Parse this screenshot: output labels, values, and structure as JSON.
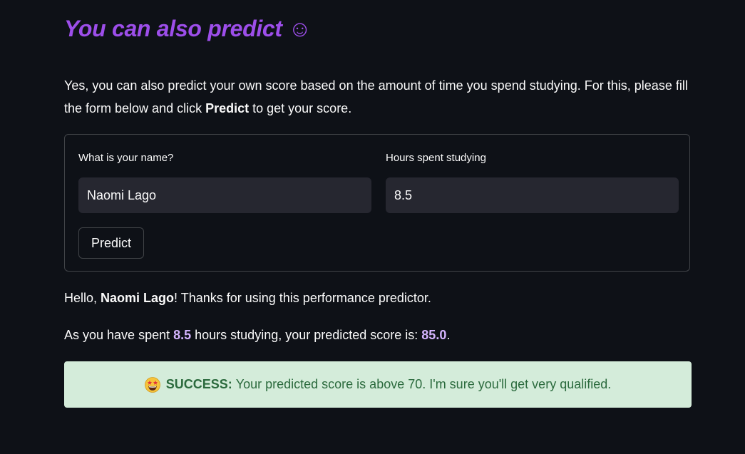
{
  "header": {
    "title": "You can also predict",
    "title_emoji": "☺"
  },
  "intro": {
    "text_before": "Yes, you can also predict your own score based on the amount of time you spend studying. For this, please fill the form below and click ",
    "bold": "Predict",
    "text_after": " to get your score."
  },
  "form": {
    "name_label": "What is your name?",
    "name_value": "Naomi Lago",
    "hours_label": "Hours spent studying",
    "hours_value": "8.5",
    "predict_label": "Predict"
  },
  "result": {
    "greeting_prefix": "Hello, ",
    "greeting_name": "Naomi Lago",
    "greeting_suffix": "! Thanks for using this performance predictor.",
    "score_prefix": "As you have spent ",
    "score_hours": "8.5",
    "score_mid": " hours studying, your predicted score is: ",
    "score_value": "85.0",
    "score_suffix": "."
  },
  "alert": {
    "icon": "star-struck-emoji-icon",
    "label": "SUCCESS:",
    "message": "Your predicted score is above 70. I'm sure you'll get very qualified.",
    "bg_color": "#d4ecda",
    "text_color": "#2b6a3d"
  },
  "colors": {
    "background": "#0e1117",
    "title": "#9d4eea",
    "highlight": "#d4b4fe",
    "input_bg": "#262730"
  }
}
